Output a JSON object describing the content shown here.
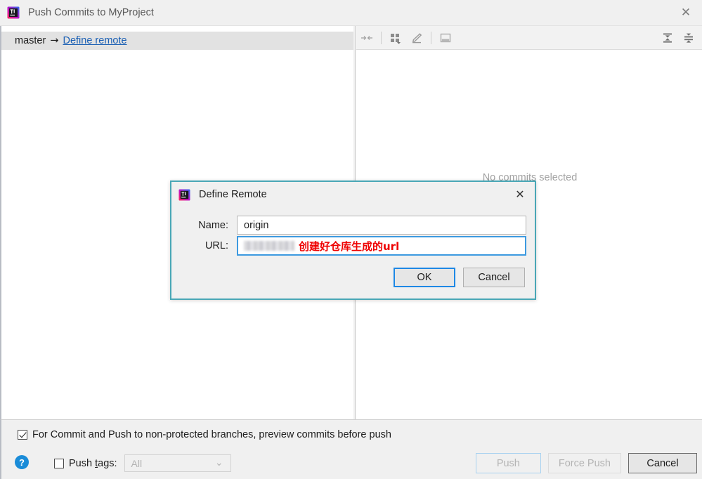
{
  "window": {
    "title": "Push Commits to MyProject",
    "icon": "intellij-idea-icon",
    "close_label": "✕"
  },
  "left_pane": {
    "branch": {
      "name": "master",
      "arrow": "→",
      "remote_link": "Define remote"
    }
  },
  "right_pane": {
    "toolbar": {
      "items": [
        {
          "name": "collapse-to-center-icon",
          "tooltip": ""
        },
        {
          "name": "group-by-icon",
          "tooltip": ""
        },
        {
          "name": "edit-icon",
          "tooltip": ""
        },
        {
          "name": "show-diff-preview-icon",
          "tooltip": ""
        },
        {
          "name": "expand-all-icon",
          "tooltip": ""
        },
        {
          "name": "collapse-all-icon",
          "tooltip": ""
        }
      ]
    },
    "empty_state": "No commits selected"
  },
  "bottom": {
    "preview_checkbox": {
      "label": "For Commit and Push to non-protected branches, preview commits before push",
      "checked": true
    },
    "help_icon_label": "?",
    "push_tags": {
      "label_before": "Push ",
      "label_mnemonic": "t",
      "label_after": "ags:",
      "checked": false,
      "dropdown_value": "All",
      "dropdown_chevron": "⌄"
    },
    "buttons": {
      "push": "Push",
      "force_push": "Force Push",
      "cancel": "Cancel"
    }
  },
  "dialog": {
    "title": "Define Remote",
    "icon": "intellij-idea-icon",
    "close_label": "✕",
    "name_label": "Name:",
    "name_value": "origin",
    "url_label": "URL:",
    "url_value_blurred": "",
    "url_annotation": "创建好仓库生成的url",
    "ok_label": "OK",
    "cancel_label": "Cancel"
  },
  "colors": {
    "dialog_border": "#49a7b6",
    "link": "#1a5fb4",
    "annotation": "#ee0000",
    "focus_blue": "#1e88e5",
    "help_blue": "#1a8cd8"
  }
}
